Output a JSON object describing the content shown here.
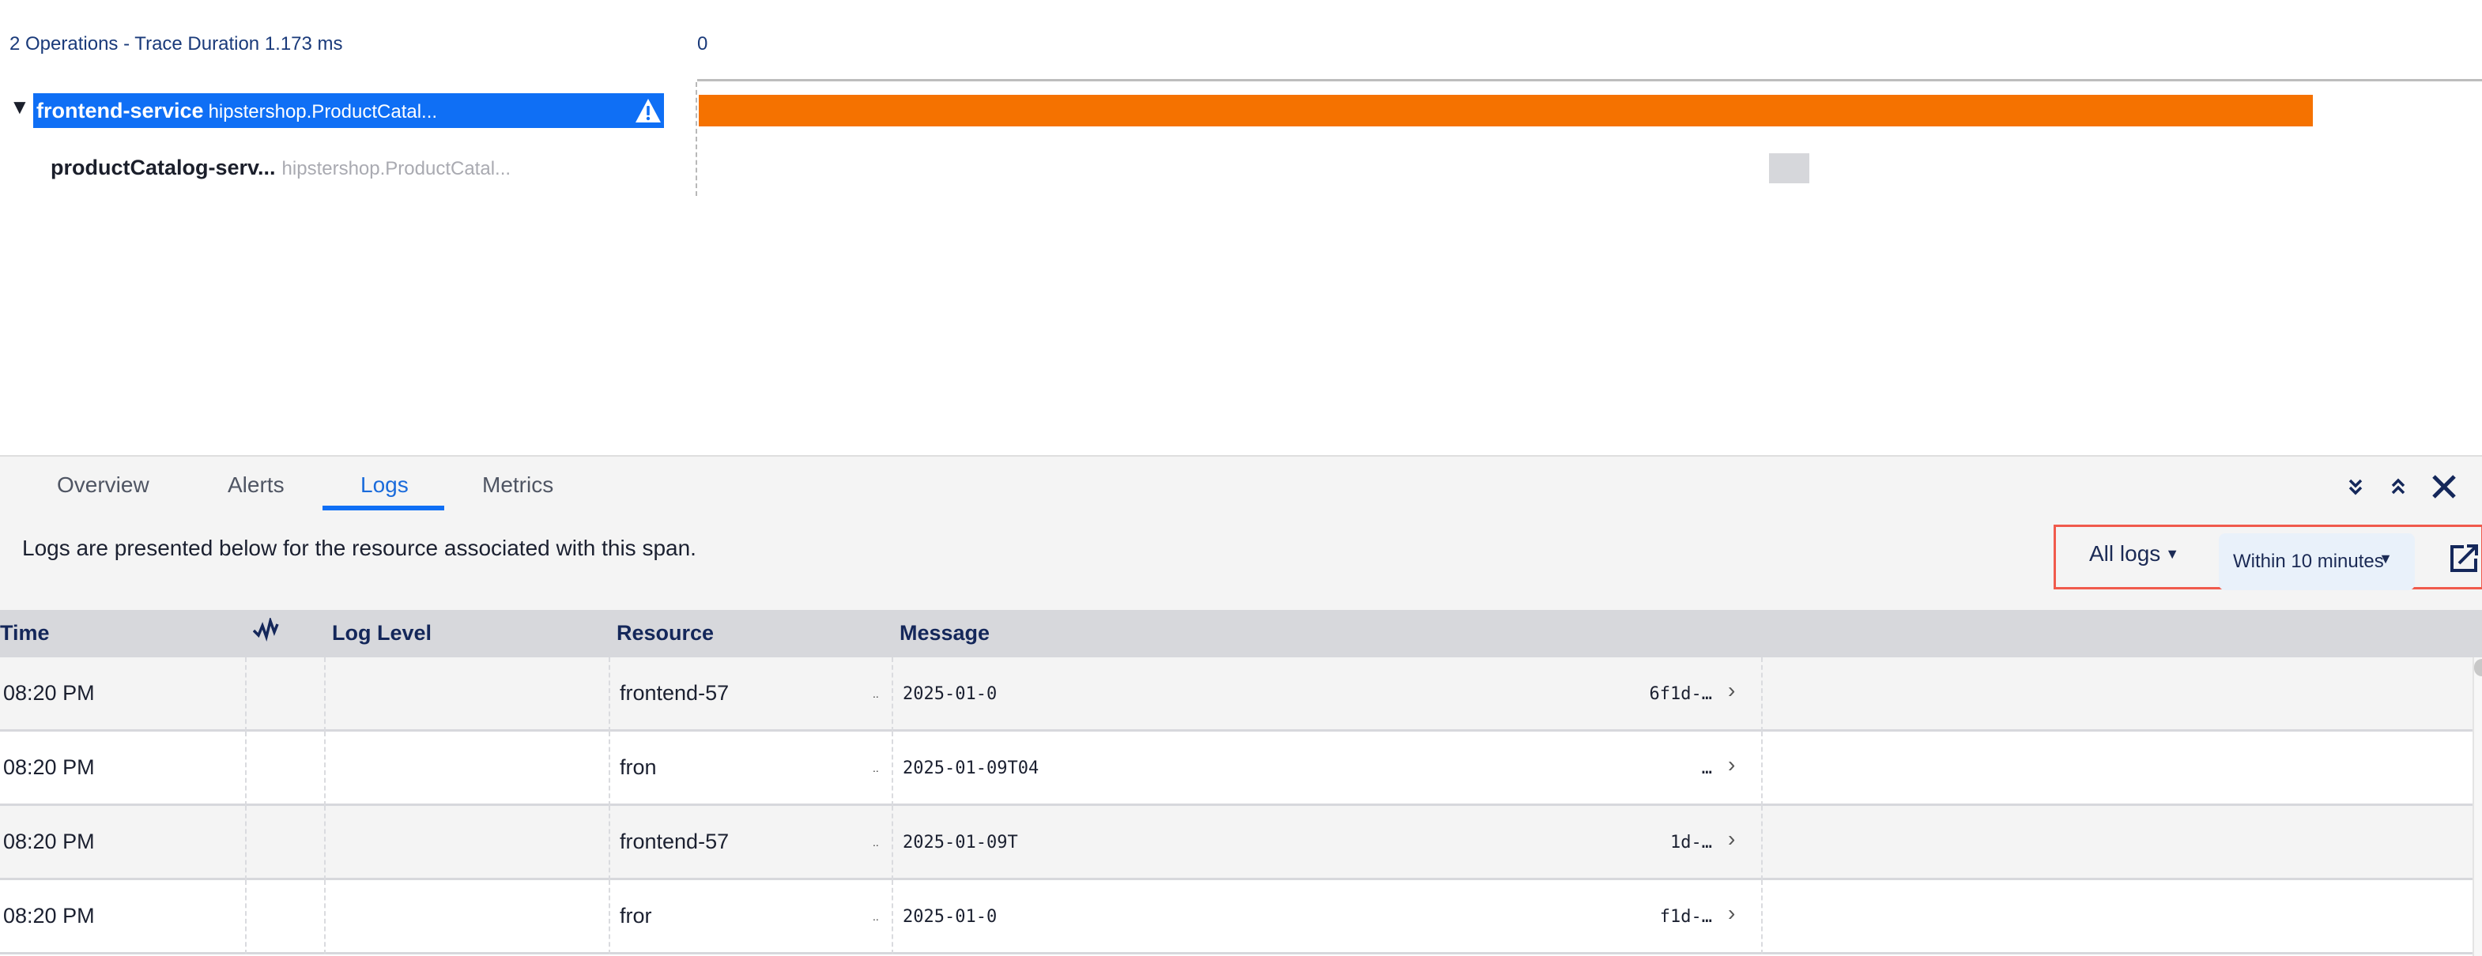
{
  "trace": {
    "summary": "2 Operations - Trace Duration 1.173 ms",
    "axis_start_label": "0",
    "duration_ms": 1.173,
    "spans": [
      {
        "service": "frontend-service",
        "operation": "hipstershop.ProductCatal...",
        "selected": true,
        "expanded": true,
        "warning_icon": "warning-triangle-icon",
        "bar_color": "#f57200",
        "start_fraction": 0.0,
        "end_fraction": 0.905
      },
      {
        "service": "productCatalog-serv...",
        "operation": "hipstershop.ProductCatal...",
        "selected": false,
        "bar_color": "#d6d7db",
        "start_fraction": 0.6,
        "end_fraction": 0.623
      }
    ]
  },
  "panel": {
    "tabs": [
      {
        "label": "Overview",
        "active": false
      },
      {
        "label": "Alerts",
        "active": false
      },
      {
        "label": "Logs",
        "active": true
      },
      {
        "label": "Metrics",
        "active": false
      }
    ],
    "icons": [
      "collapse-down-icon",
      "expand-up-icon",
      "close-icon"
    ],
    "description": "Logs are presented below for the resource associated with this span.",
    "filters": {
      "log_type": "All logs",
      "time_range": "Within 10 minutes",
      "open_external_icon": "open-external-icon"
    }
  },
  "logs_table": {
    "columns": [
      "Time",
      "",
      "Log Level",
      "Resource",
      "Message"
    ],
    "rows": [
      {
        "time": "08:20 PM",
        "level": "",
        "resource": "frontend-57",
        "message_start": "2025-01-0",
        "message_end": "6f1d-…"
      },
      {
        "time": "08:20 PM",
        "level": "",
        "resource": "fron",
        "message_start": "2025-01-09T04",
        "message_end": "…"
      },
      {
        "time": "08:20 PM",
        "level": "",
        "resource": "frontend-57",
        "message_start": "2025-01-09T",
        "message_end": "1d-…"
      },
      {
        "time": "08:20 PM",
        "level": "",
        "resource": "fror",
        "message_start": "2025-01-0",
        "message_end": "f1d-…"
      }
    ]
  },
  "colors": {
    "accent": "#0f6ff5",
    "span_error": "#f57200",
    "highlight_border": "#f05a4c",
    "text_navy": "#14275a"
  }
}
